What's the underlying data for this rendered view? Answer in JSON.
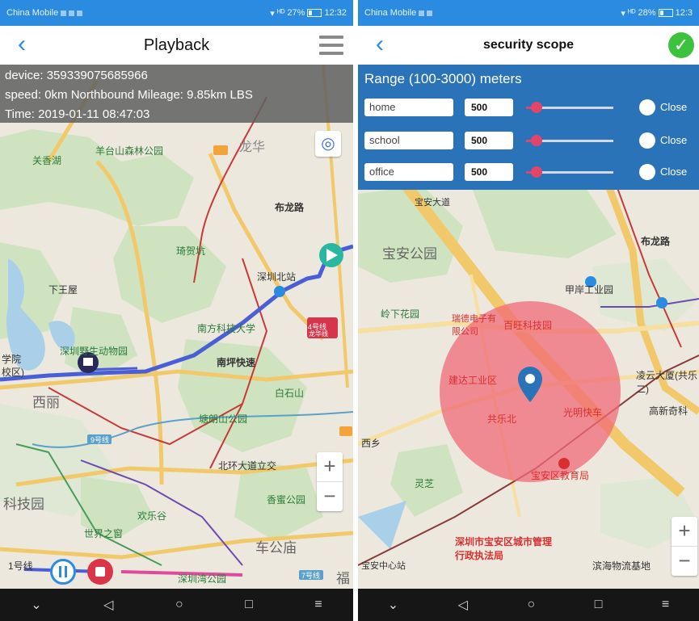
{
  "left": {
    "status": {
      "carrier": "China Mobile",
      "signal": "ᴴᴰ",
      "battery": "27%",
      "time": "12:32"
    },
    "title": "Playback",
    "info": {
      "device": "device: 359339075685966",
      "speed": "speed:  0km Northbound Mileage:  9.85km LBS",
      "time": "Time:  2019-01-11 08:47:03"
    },
    "map_labels": [
      "羊台山森林公园",
      "龙华",
      "布龙路",
      "琦贺坑",
      "深圳北站",
      "南方科技大学",
      "深圳野生动物园",
      "南坪快速",
      "白石山",
      "塘朗山公园",
      "北环大道立交",
      "西丽",
      "香蜜公园",
      "世界之窗",
      "欢乐谷",
      "车公庙",
      "深圳湾公园",
      "科技园",
      "下王屋",
      "关香湖",
      "学院",
      "校区)",
      "4号线",
      "龙华线",
      "9号线",
      "7号线",
      "1号线",
      "福"
    ],
    "zoom": {
      "plus": "+",
      "minus": "−"
    }
  },
  "right": {
    "status": {
      "carrier": "China Mobile",
      "signal": "ᴴᴰ",
      "battery": "28%",
      "time": "12:3"
    },
    "title": "security scope",
    "range_label": "Range (100-3000) meters",
    "zones": [
      {
        "name": "home",
        "value": "500",
        "fraction": 0.12,
        "toggle_label": "Close"
      },
      {
        "name": "school",
        "value": "500",
        "fraction": 0.12,
        "toggle_label": "Close"
      },
      {
        "name": "office",
        "value": "500",
        "fraction": 0.12,
        "toggle_label": "Close"
      }
    ],
    "map_labels": [
      "宝安公园",
      "岭下花园",
      "瑞德电子有限公司",
      "百旺科技园",
      "甲岸工业园",
      "凌云大厦(共乐二)",
      "建达工业区",
      "共乐北",
      "光明快车",
      "高新奇科",
      "宝安区教育局",
      "深圳市宝安区城市管理行政执法局",
      "滨海物流基地",
      "灵芝",
      "宝安中心站",
      "西乡",
      "宝安大道",
      "布龙路"
    ],
    "zoom": {
      "plus": "+",
      "minus": "−"
    }
  },
  "nav": {
    "menu": "⌄",
    "back": "◁",
    "home": "○",
    "recents": "□",
    "more": "≡"
  },
  "colors": {
    "status_bar": "#2a8be0",
    "panel": "#2a73b8",
    "track": "#4a5fd6",
    "geofence": "#f06a78",
    "accent_green": "#3cc23c",
    "slider": "#e0456b"
  }
}
